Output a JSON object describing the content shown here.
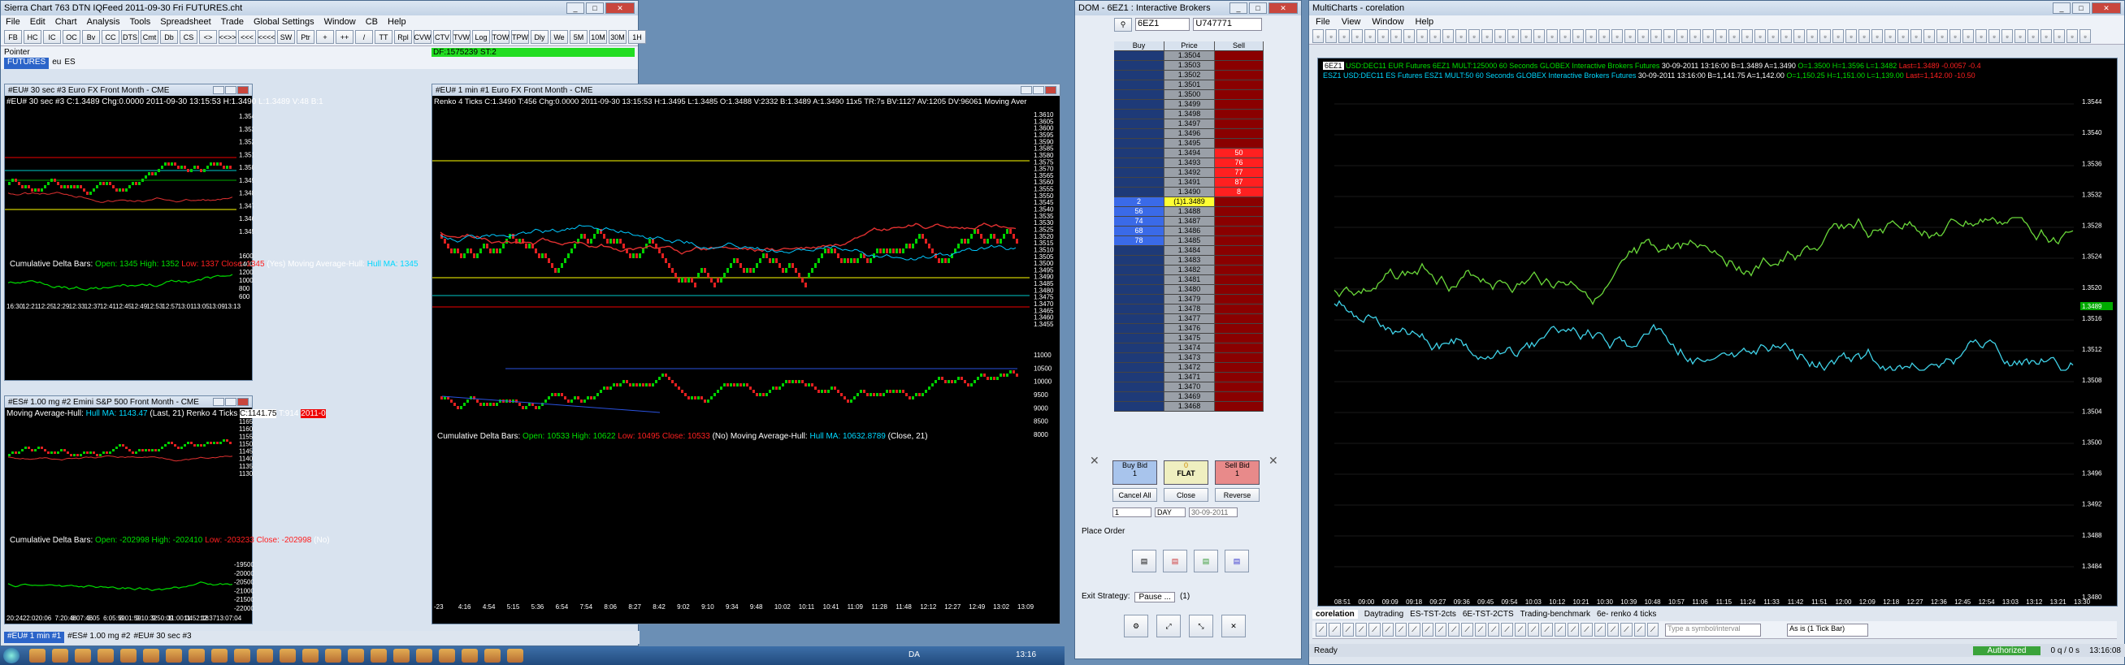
{
  "sierra": {
    "title": "Sierra Chart 763 DTN IQFeed 2011-09-30 Fri  FUTURES.cht",
    "menu": [
      "File",
      "Edit",
      "Chart",
      "Analysis",
      "Tools",
      "Spreadsheet",
      "Trade",
      "Global Settings",
      "Window",
      "CB",
      "Help"
    ],
    "toolbar": [
      "FB",
      "HC",
      "IC",
      "OC",
      "Bv",
      "CC",
      "DTS",
      "Cmt",
      "Db",
      "CS",
      "<>",
      "<<>>",
      "<<<",
      "<<<<",
      "SW",
      "Ptr",
      "+",
      "++",
      "/",
      "TT",
      "Rpl",
      "CVW",
      "CTV",
      "TVW",
      "Log",
      "TOW",
      "TPW",
      "Dly",
      "We",
      "5M",
      "10M",
      "30M",
      "1H"
    ],
    "pointer_label": "Pointer",
    "status_green": "DF:1575239  ST:2",
    "tabs": [
      "FUTURES",
      "eu",
      "ES"
    ],
    "bottom_tabs": [
      "#EU# 1 min #1",
      "#ES# 1.00 mg #2",
      "#EU# 30 sec #3"
    ]
  },
  "chart1": {
    "title": "#EU# 30 sec  #3  Euro FX Front Month - CME",
    "info": "#EU# 30 sec  #3  C:1.3489 Chg:0.0000  2011-09-30 13:15:53 H:1.3490 L:1.3489 V:48 B:1",
    "y_ticks": [
      "1.3540",
      "1.3530",
      "1.3520",
      "1.3510",
      "1.3500",
      "1.3490",
      "1.3480",
      "1.3470",
      "1.3460",
      "1.3450"
    ],
    "cum_label": "Cumulative Delta Bars:",
    "cum_open": "Open: 1345",
    "cum_high": "High: 1352",
    "cum_low": "Low: 1337",
    "cum_close": "Close: 1345",
    "cum_extra": "(Yes)  Moving Average-Hull:",
    "hull": "Hull MA: 1345",
    "sub_ticks": [
      "1600",
      "1400",
      "1200",
      "1000",
      "800",
      "600"
    ],
    "x_ticks": [
      "16:30",
      "12:21",
      "12:25",
      "12:29",
      "12:33",
      "12:37",
      "12:41",
      "12:45",
      "12:49",
      "12:53",
      "12:57",
      "13:01",
      "13:05",
      "13:09",
      "13:13"
    ]
  },
  "chart2": {
    "title": "#EU# 1 min  #1  Euro FX Front Month - CME",
    "info": "Renko 4 Ticks  C:1.3490  T:456  Chg:0.0000  2011-09-30 13:15:53 H:1.3495 L:1.3485 O:1.3488 V:2332 B:1.3489 A:1.3490 11x5 TR:7s BV:1127 AV:1205 DV:96061 Moving Aver",
    "y_ticks": [
      "1.3610",
      "1.3605",
      "1.3600",
      "1.3595",
      "1.3590",
      "1.3585",
      "1.3580",
      "1.3575",
      "1.3570",
      "1.3565",
      "1.3560",
      "1.3555",
      "1.3550",
      "1.3545",
      "1.3540",
      "1.3535",
      "1.3530",
      "1.3525",
      "1.3520",
      "1.3515",
      "1.3510",
      "1.3505",
      "1.3500",
      "1.3495",
      "1.3490",
      "1.3485",
      "1.3480",
      "1.3475",
      "1.3470",
      "1.3465",
      "1.3460",
      "1.3455"
    ],
    "cum_label": "Cumulative Delta Bars:",
    "cum_open": "Open: 10533",
    "cum_high": "High: 10622",
    "cum_low": "Low: 10495",
    "cum_close": "Close: 10533",
    "cum_extra": "(No)  Moving Average-Hull:",
    "hull": "Hull MA: 10632.8789",
    "hull_tail": "(Close, 21)",
    "sub_ticks": [
      "11000",
      "10500",
      "10000",
      "9500",
      "9000",
      "8500",
      "8000"
    ],
    "x_ticks": [
      "-23",
      "4:16",
      "4:54",
      "5:15",
      "5:36",
      "6:54",
      "7:54",
      "8:06",
      "8:27",
      "8:42",
      "9:02",
      "9:10",
      "9:34",
      "9:48",
      "10:02",
      "10:11",
      "10:41",
      "11:09",
      "11:28",
      "11:48",
      "12:12",
      "12:27",
      "12:49",
      "13:02",
      "13:09"
    ]
  },
  "chart3": {
    "title": "#ES# 1.00 mg  #2  Emini S&P 500 Front Month - CME",
    "info_a": "Moving Average-Hull:",
    "info_hull": "Hull MA: 1143.47",
    "info_b": "(Last, 21)  Renko 4 Ticks",
    "info_c": "C:1141.75",
    "info_d": "T:914",
    "info_e": "2011-0",
    "y_ticks": [
      "1165.00",
      "1160.00",
      "1155.00",
      "1150.00",
      "1145.00",
      "1140.00",
      "1135.00",
      "1130.00"
    ],
    "cum_label": "Cumulative Delta Bars:",
    "cum_open": "Open: -202998",
    "cum_high": "High: -202410",
    "cum_low": "Low: -203233",
    "cum_close": "Close: -202998",
    "cum_extra": "(No)",
    "sub_ticks": [
      "-195000",
      "-200000",
      "-205000",
      "-210000",
      "-215000",
      "-220000"
    ],
    "x_ticks": [
      "20:24",
      "22:02",
      "0:06",
      "7:20:48",
      "8:07:46",
      "5:05",
      "6:05:59",
      "8:01:59",
      "9:10:32",
      "9:50:09",
      "11:00:04",
      "11:52:18",
      "12:37",
      "13:07:04"
    ]
  },
  "dom": {
    "title": "DOM - 6EZ1 : Interactive Brokers",
    "symbol": "6EZ1",
    "account": "U747771",
    "headers": [
      "Buy",
      "Price",
      "Sell"
    ],
    "ask_prices": [
      "1.3504",
      "1.3503",
      "1.3502",
      "1.3501",
      "1.3500",
      "1.3499",
      "1.3498",
      "1.3497",
      "1.3496",
      "1.3495",
      "1.3494",
      "1.3493",
      "1.3492",
      "1.3491",
      "1.3490"
    ],
    "ask_sizes": [
      "",
      "",
      "",
      "",
      "",
      "",
      "",
      "",
      "",
      "",
      "50",
      "76",
      "77",
      "87",
      "8"
    ],
    "last_row": "(1)1.3489",
    "last_bid": "2",
    "bid_prices": [
      "1.3488",
      "1.3487",
      "1.3486",
      "1.3485",
      "1.3484",
      "1.3483",
      "1.3482",
      "1.3481",
      "1.3480",
      "1.3479",
      "1.3478",
      "1.3477",
      "1.3476",
      "1.3475",
      "1.3474",
      "1.3473",
      "1.3472",
      "1.3471",
      "1.3470",
      "1.3469",
      "1.3468"
    ],
    "bid_sizes": [
      "56",
      "74",
      "68",
      "78",
      "",
      "",
      "",
      "",
      "",
      "",
      "",
      "",
      "",
      "",
      "",
      "",
      "",
      "",
      "",
      "",
      ""
    ],
    "buy_bid": "Buy Bid",
    "buy_bid_qty": "1",
    "position_label": "FLAT",
    "position_qty": "0",
    "sell_bid": "Sell Bid",
    "sell_bid_qty": "1",
    "cancel_all": "Cancel All",
    "close": "Close",
    "reverse": "Reverse",
    "qty": "1",
    "tif": "DAY",
    "date": "30-09-2011",
    "place_order": "Place Order",
    "exit_strategy": "Exit Strategy:",
    "exit_value": "Pause ...",
    "exit_count": "(1)"
  },
  "mc": {
    "title": "MultiCharts - corelation",
    "menu": [
      "File",
      "View",
      "Window",
      "Help"
    ],
    "legend1_a": "6EZ1",
    "legend1_b": "USD:DEC11 EUR Futures 6EZ1 MULT:125000  60 Seconds",
    "legend1_c": "GLOBEX  Interactive Brokers  Futures",
    "legend1_d": "30-09-2011  13:16:00  B=1.3489 A=1.3490",
    "legend1_e": "O=1.3500 H=1.3596 L=1.3482",
    "legend1_f": "Last=1.3489 -0.0057 -0.4",
    "legend2_a": "ESZ1",
    "legend2_b": "USD:DEC11 ES Futures ESZ1 MULT:50  60 Seconds",
    "legend2_c": "GLOBEX  Interactive Brokers  Futures",
    "legend2_d": "30-09-2011  13:16:00  B=1,141.75 A=1,142.00",
    "legend2_e": "O=1,150.25 H=1,151.00 L=1,139.00",
    "legend2_f": "Last=1,142.00 -10.50",
    "y_ticks": [
      "1.3544",
      "1.3540",
      "1.3536",
      "1.3532",
      "1.3528",
      "1.3524",
      "1.3520",
      "1.3516",
      "1.3512",
      "1.3508",
      "1.3504",
      "1.3500",
      "1.3496",
      "1.3492",
      "1.3488",
      "1.3484",
      "1.3480"
    ],
    "y_badge": "1.3489",
    "x_ticks": [
      "08:51",
      "09:00",
      "09:09",
      "09:18",
      "09:27",
      "09:36",
      "09:45",
      "09:54",
      "10:03",
      "10:12",
      "10:21",
      "10:30",
      "10:39",
      "10:48",
      "10:57",
      "11:06",
      "11:15",
      "11:24",
      "11:33",
      "11:42",
      "11:51",
      "12:00",
      "12:09",
      "12:18",
      "12:27",
      "12:36",
      "12:45",
      "12:54",
      "13:03",
      "13:12",
      "13:21",
      "13:30"
    ],
    "tabs": [
      "corelation",
      "Daytrading",
      "ES-TST-2cts",
      "6E-TST-2CTS",
      "Trading-benchmark",
      "6e- renko 4 ticks"
    ],
    "symbol_placeholder": "Type a symbol/interval",
    "interval": "As is (1 Tick Bar)",
    "status_ready": "Ready",
    "status_auth": "Authorized",
    "status_ratio": "0 q / 0 s",
    "status_time": "13:16:08"
  },
  "taskbar": {
    "time": "13:16",
    "lang": "DA"
  }
}
